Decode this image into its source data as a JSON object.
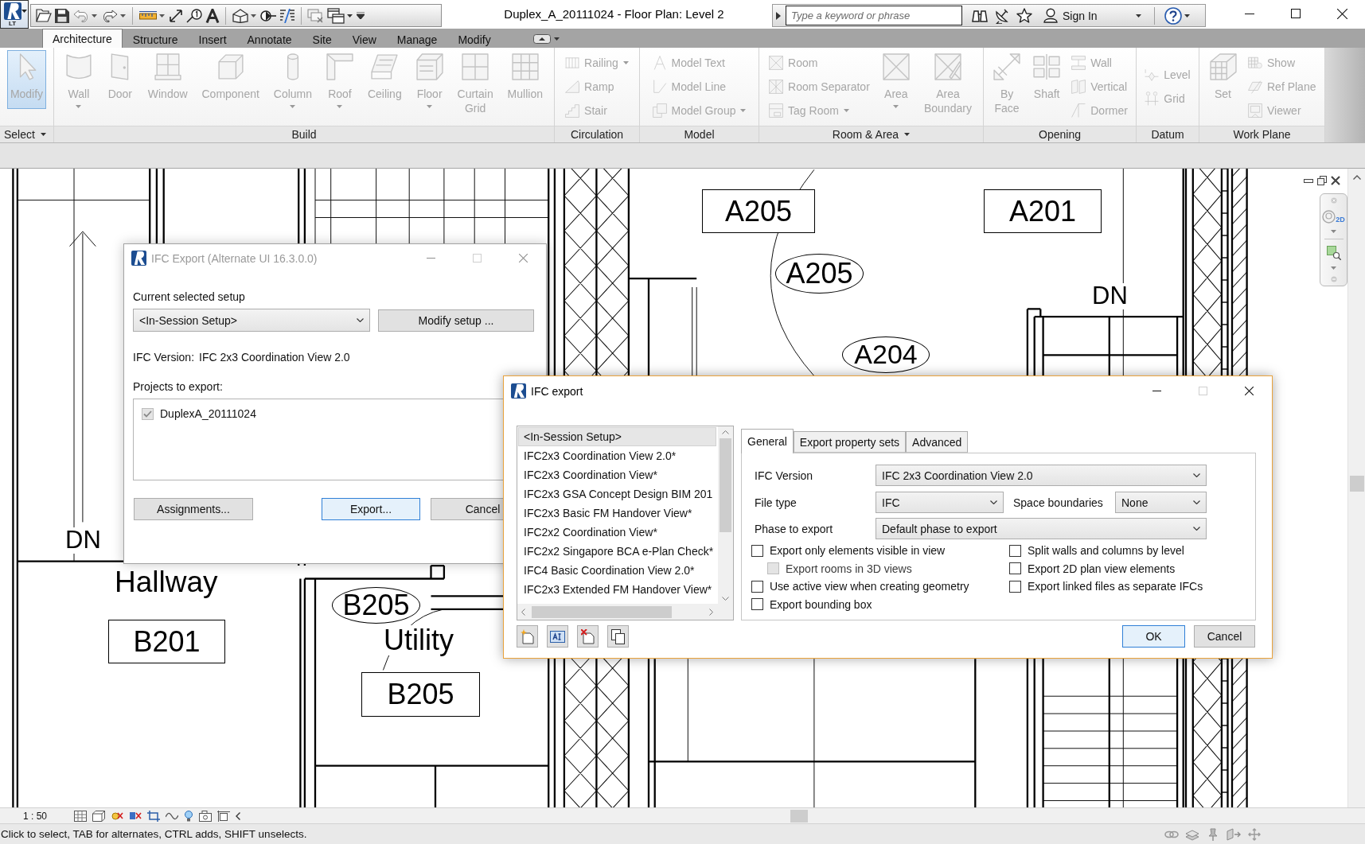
{
  "title_bar": {
    "app_badge": "LT",
    "title": "Duplex_A_20111024 - Floor Plan: Level 2",
    "search": {
      "placeholder": "Type a keyword or phrase"
    },
    "sign_in": "Sign In"
  },
  "ribbon": {
    "tabs": [
      {
        "label": "Architecture",
        "selected": true
      },
      {
        "label": "Structure",
        "selected": false
      },
      {
        "label": "Insert",
        "selected": false
      },
      {
        "label": "Annotate",
        "selected": false
      },
      {
        "label": "Site",
        "selected": false
      },
      {
        "label": "View",
        "selected": false
      },
      {
        "label": "Manage",
        "selected": false
      },
      {
        "label": "Modify",
        "selected": false
      }
    ],
    "panels": [
      {
        "title": "Select",
        "dropdown": true,
        "items": [
          {
            "kind": "large",
            "label": "Modify",
            "active": true,
            "dropdown": false,
            "disabled": true
          }
        ]
      },
      {
        "title": "Build",
        "dropdown": false,
        "items": [
          {
            "kind": "large",
            "label": "Wall",
            "active": false,
            "dropdown": true,
            "disabled": true
          },
          {
            "kind": "large",
            "label": "Door",
            "active": false,
            "dropdown": false,
            "disabled": true
          },
          {
            "kind": "large",
            "label": "Window",
            "active": false,
            "dropdown": false,
            "disabled": true
          },
          {
            "kind": "large",
            "label": "Component",
            "active": false,
            "dropdown": false,
            "disabled": true
          },
          {
            "kind": "large",
            "label": "Column",
            "active": false,
            "dropdown": true,
            "disabled": true
          },
          {
            "kind": "large",
            "label": "Roof",
            "active": false,
            "dropdown": true,
            "disabled": true
          },
          {
            "kind": "large",
            "label": "Ceiling",
            "active": false,
            "dropdown": false,
            "disabled": true
          },
          {
            "kind": "large",
            "label": "Floor",
            "active": false,
            "dropdown": true,
            "disabled": true
          },
          {
            "kind": "large",
            "label": "Curtain Grid",
            "active": false,
            "dropdown": false,
            "disabled": true
          },
          {
            "kind": "large",
            "label": "Mullion",
            "active": false,
            "dropdown": false,
            "disabled": true
          }
        ]
      },
      {
        "title": "Circulation",
        "dropdown": false,
        "items": [
          {
            "kind": "stack",
            "tools": [
              {
                "label": "Railing",
                "dropdown": true,
                "disabled": true
              },
              {
                "label": "Ramp",
                "dropdown": false,
                "disabled": true
              },
              {
                "label": "Stair",
                "dropdown": false,
                "disabled": true
              }
            ]
          }
        ]
      },
      {
        "title": "Model",
        "dropdown": false,
        "items": [
          {
            "kind": "stack",
            "tools": [
              {
                "label": "Model Text",
                "dropdown": false,
                "disabled": true
              },
              {
                "label": "Model Line",
                "dropdown": false,
                "disabled": true
              },
              {
                "label": "Model Group",
                "dropdown": true,
                "disabled": true
              }
            ]
          }
        ]
      },
      {
        "title": "Room & Area",
        "dropdown": true,
        "items": [
          {
            "kind": "stack",
            "tools": [
              {
                "label": "Room",
                "dropdown": false,
                "disabled": true
              },
              {
                "label": "Room Separator",
                "dropdown": false,
                "disabled": true
              },
              {
                "label": "Tag Room",
                "dropdown": true,
                "disabled": true
              }
            ]
          },
          {
            "kind": "large",
            "label": "Area",
            "active": false,
            "dropdown": true,
            "disabled": true
          },
          {
            "kind": "large",
            "label": "Area Boundary",
            "active": false,
            "dropdown": false,
            "disabled": true
          }
        ]
      },
      {
        "title": "Opening",
        "dropdown": false,
        "items": [
          {
            "kind": "large",
            "label": "By Face",
            "active": false,
            "dropdown": false,
            "disabled": true
          },
          {
            "kind": "large",
            "label": "Shaft",
            "active": false,
            "dropdown": false,
            "disabled": true
          },
          {
            "kind": "stack",
            "tools": [
              {
                "label": "Wall",
                "dropdown": false,
                "disabled": true
              },
              {
                "label": "Vertical",
                "dropdown": false,
                "disabled": true
              },
              {
                "label": "Dormer",
                "dropdown": false,
                "disabled": true
              }
            ]
          }
        ]
      },
      {
        "title": "Datum",
        "dropdown": false,
        "items": [
          {
            "kind": "stack",
            "tools": [
              {
                "label": "Level",
                "dropdown": false,
                "disabled": true
              },
              {
                "label": "Grid",
                "dropdown": false,
                "disabled": true
              }
            ]
          }
        ]
      },
      {
        "title": "Work Plane",
        "dropdown": false,
        "items": [
          {
            "kind": "large",
            "label": "Set",
            "active": false,
            "dropdown": false,
            "disabled": true
          },
          {
            "kind": "stack",
            "tools": [
              {
                "label": "Show",
                "dropdown": false,
                "disabled": true
              },
              {
                "label": "Ref Plane",
                "dropdown": false,
                "disabled": true
              },
              {
                "label": "Viewer",
                "dropdown": false,
                "disabled": true
              }
            ]
          }
        ]
      }
    ]
  },
  "floor_plan": {
    "labels": [
      {
        "text": "A205",
        "kind": "boxed"
      },
      {
        "text": "A201",
        "kind": "boxed"
      },
      {
        "text": "A205",
        "kind": "tagged"
      },
      {
        "text": "DN",
        "kind": "plain"
      },
      {
        "text": "A204",
        "kind": "tagged"
      },
      {
        "text": "DN",
        "kind": "plain"
      },
      {
        "text": "Hallway",
        "kind": "plain"
      },
      {
        "text": "B201",
        "kind": "boxed"
      },
      {
        "text": "B205",
        "kind": "tagged"
      },
      {
        "text": "Utility",
        "kind": "plain"
      },
      {
        "text": "B205",
        "kind": "boxed"
      }
    ]
  },
  "navigation_bar": {
    "wheel_badge": "2D"
  },
  "alternate_export_dialog": {
    "title": "IFC Export (Alternate UI 16.3.0.0)",
    "active": false,
    "setup_label": "Current selected setup",
    "setup_value": "<In-Session Setup>",
    "modify_button": "Modify setup ...",
    "ifc_version_label": "IFC Version:",
    "ifc_version": "IFC 2x3 Coordination View 2.0",
    "projects_label": "Projects to export:",
    "projects": [
      {
        "label": "DuplexA_20111024",
        "checked": true,
        "disabled": true
      }
    ],
    "buttons": [
      {
        "label": "Assignments...",
        "default": false
      },
      {
        "label": "Export...",
        "default": true
      },
      {
        "label": "Cancel",
        "default": false
      }
    ]
  },
  "export_dialog": {
    "title": "IFC export",
    "active": true,
    "setups": [
      {
        "label": "<In-Session Setup>",
        "selected": true
      },
      {
        "label": "IFC2x3 Coordination View 2.0*",
        "selected": false
      },
      {
        "label": "IFC2x3 Coordination View*",
        "selected": false
      },
      {
        "label": "IFC2x3 GSA Concept Design BIM 201",
        "selected": false
      },
      {
        "label": "IFC2x3 Basic FM Handover View*",
        "selected": false
      },
      {
        "label": "IFC2x2 Coordination View*",
        "selected": false
      },
      {
        "label": "IFC2x2 Singapore BCA e-Plan Check*",
        "selected": false
      },
      {
        "label": "IFC4 Basic Coordination View 2.0*",
        "selected": false
      },
      {
        "label": "IFC2x3 Extended FM Handover View*",
        "selected": false
      }
    ],
    "tabs": [
      {
        "label": "General",
        "selected": true
      },
      {
        "label": "Export property sets",
        "selected": false
      },
      {
        "label": "Advanced",
        "selected": false
      }
    ],
    "general": {
      "ifc_version": {
        "label": "IFC Version",
        "value": "IFC 2x3 Coordination View 2.0"
      },
      "file_type": {
        "label": "File type",
        "value": "IFC"
      },
      "space_boundaries": {
        "label": "Space boundaries",
        "value": "None"
      },
      "phase": {
        "label": "Phase to export",
        "value": "Default phase to export"
      },
      "option_columns": [
        {
          "options": [
            {
              "label": "Export only elements visible in view",
              "checked": false,
              "disabled": false,
              "children": [
                {
                  "label": "Export rooms in 3D views",
                  "checked": false,
                  "disabled": true
                }
              ]
            },
            {
              "label": "Use active view when creating geometry",
              "checked": false,
              "disabled": false
            },
            {
              "label": "Export bounding box",
              "checked": false,
              "disabled": false
            }
          ]
        },
        {
          "options": [
            {
              "label": "Split walls and columns by level",
              "checked": false,
              "disabled": false
            },
            {
              "label": "Export 2D plan view elements",
              "checked": false,
              "disabled": false
            },
            {
              "label": "Export linked files as separate IFCs",
              "checked": false,
              "disabled": false
            }
          ]
        }
      ]
    },
    "buttons": [
      {
        "label": "OK",
        "default": true
      },
      {
        "label": "Cancel",
        "default": false
      }
    ]
  },
  "view_control_bar": {
    "scale": "1 : 50"
  },
  "status_bar": {
    "message": "Click to select, TAB for alternates, CTRL adds, SHIFT unselects."
  }
}
